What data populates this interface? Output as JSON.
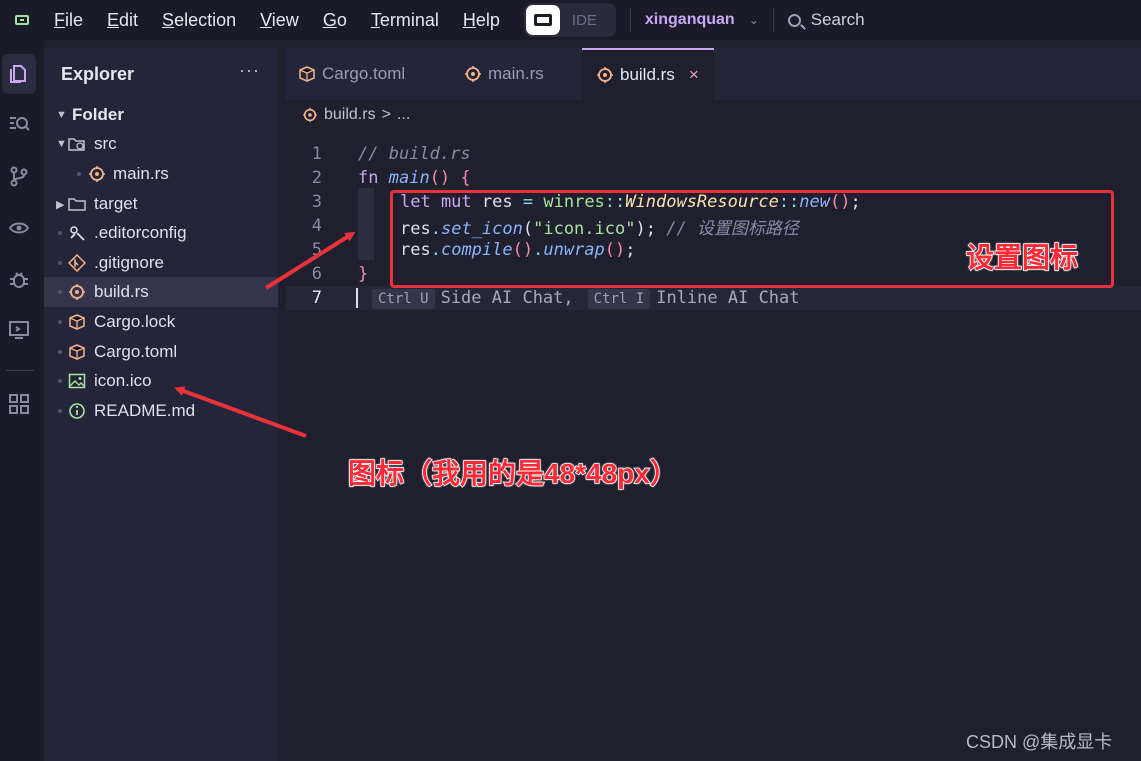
{
  "menubar": {
    "items": [
      "File",
      "Edit",
      "Selection",
      "View",
      "Go",
      "Terminal",
      "Help"
    ],
    "ide_label": "IDE",
    "user": "xinganquan",
    "search_label": "Search"
  },
  "explorer": {
    "title": "Explorer",
    "more": "···",
    "folder": "Folder",
    "items": [
      {
        "label": "src",
        "icon": "folder-sync-icon"
      },
      {
        "label": "main.rs",
        "icon": "rust-icon"
      },
      {
        "label": "target",
        "icon": "folder-icon"
      },
      {
        "label": ".editorconfig",
        "icon": "editorconfig-icon"
      },
      {
        "label": ".gitignore",
        "icon": "git-icon"
      },
      {
        "label": "build.rs",
        "icon": "rust-icon"
      },
      {
        "label": "Cargo.lock",
        "icon": "cargo-icon"
      },
      {
        "label": "Cargo.toml",
        "icon": "cargo-icon"
      },
      {
        "label": "icon.ico",
        "icon": "image-icon"
      },
      {
        "label": "README.md",
        "icon": "info-icon"
      }
    ]
  },
  "tabs": [
    {
      "label": "Cargo.toml"
    },
    {
      "label": "main.rs"
    },
    {
      "label": "build.rs",
      "close": "×"
    }
  ],
  "breadcrumb": {
    "file": "build.rs",
    "sep": ">",
    "rest": "..."
  },
  "code": {
    "line_numbers": [
      "1",
      "2",
      "3",
      "4",
      "5",
      "6",
      "7"
    ],
    "l1": "// build.rs",
    "l2_kw": "fn",
    "l2_name": "main",
    "l2_paren": "()",
    "l2_brace": "{",
    "l3_let": "let mut",
    "l3_var": "res",
    "l3_eq": "=",
    "l3_mod": "winres",
    "l3_sep": "::",
    "l3_type": "WindowsResource",
    "l3_sep2": "::",
    "l3_fn": "new",
    "l3_paren": "()",
    "l3_semi": ";",
    "l4_var": "res",
    "l4_dot": ".",
    "l4_fn": "set_icon",
    "l4_open": "(",
    "l4_str": "\"icon.ico\"",
    "l4_close": ")",
    "l4_semi": ";",
    "l4_comment": "// 设置图标路径",
    "l5_var": "res",
    "l5_dot": ".",
    "l5_fn": "compile",
    "l5_paren": "()",
    "l5_dot2": ".",
    "l5_fn2": "unwrap",
    "l5_paren2": "()",
    "l5_semi": ";",
    "l6": "}",
    "hint_key1": "Ctrl U",
    "hint_text1": "Side AI Chat,",
    "hint_key2": "Ctrl I",
    "hint_text2": "Inline AI Chat"
  },
  "annotations": {
    "box_label": "设置图标",
    "icon_note": "图标（我用的是48*48px）",
    "color": "#e8323c"
  },
  "watermark": "CSDN @集成显卡"
}
